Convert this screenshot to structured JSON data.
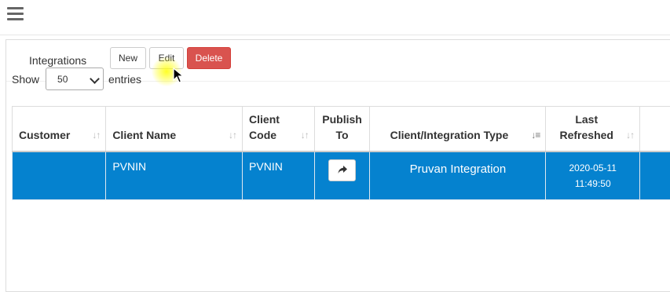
{
  "header": {
    "menu_icon": "hamburger-icon"
  },
  "panel": {
    "title": "Integrations",
    "buttons": {
      "new": "New",
      "edit": "Edit",
      "delete": "Delete"
    },
    "colors": {
      "delete": "#d9534f",
      "selected_row": "#0582cf"
    }
  },
  "length_menu": {
    "show": "Show",
    "value": "50",
    "entries": "entries"
  },
  "table": {
    "headers": {
      "customer": "Customer",
      "client_name": "Client Name",
      "client_code_1": "Client",
      "client_code_2": "Code",
      "publish_1": "Publish",
      "publish_2": "To",
      "type": "Client/Integration Type",
      "refreshed_1": "Last",
      "refreshed_2": "Refreshed"
    },
    "rows": [
      {
        "customer": "",
        "client_name": "PVNIN",
        "client_code": "PVNIN",
        "publish_icon": "share-arrow-icon",
        "type": "Pruvan Integration",
        "last_refreshed_date": "2020-05-11",
        "last_refreshed_time": "11:49:50"
      }
    ]
  }
}
